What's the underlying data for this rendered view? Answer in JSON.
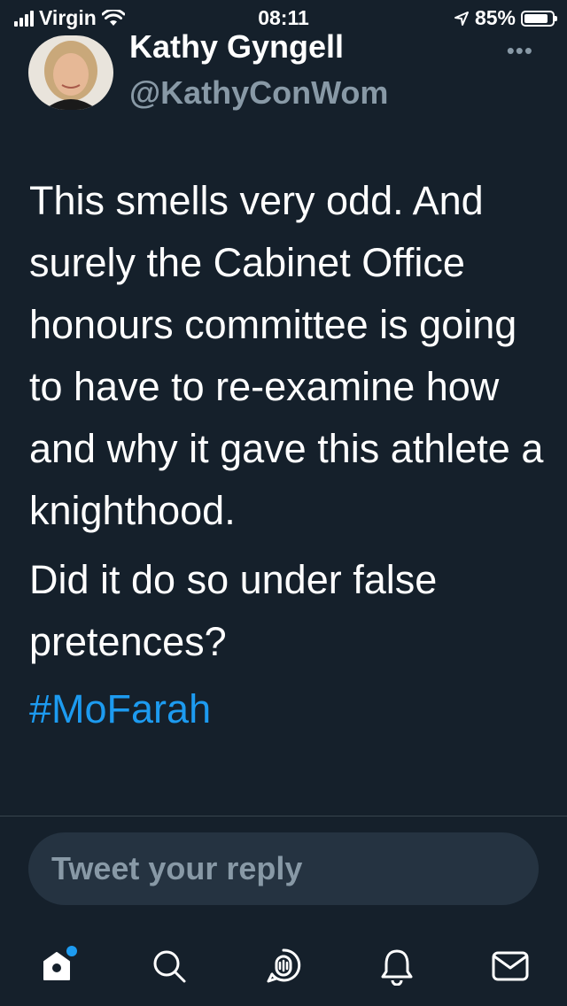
{
  "status_bar": {
    "carrier": "Virgin",
    "time": "08:11",
    "battery_percent": "85%",
    "battery_level": 0.85
  },
  "author": {
    "name": "Kathy Gyngell",
    "handle": "@KathyConWom"
  },
  "tweet": {
    "paragraph1": "This smells very odd. And surely the Cabinet Office honours committee is going to have to re-examine how and why it gave this athlete a knighthood.",
    "paragraph2": "Did it do so under false pretences?",
    "hashtag": "#MoFarah"
  },
  "reply": {
    "placeholder": "Tweet your reply"
  },
  "nav": {
    "items": [
      "home-icon",
      "search-icon",
      "spaces-icon",
      "notifications-icon",
      "messages-icon"
    ],
    "home_has_notification": true
  },
  "colors": {
    "background": "#15202b",
    "accent": "#1d9bf0",
    "secondary_text": "#8899a6",
    "reply_box": "#253341"
  }
}
